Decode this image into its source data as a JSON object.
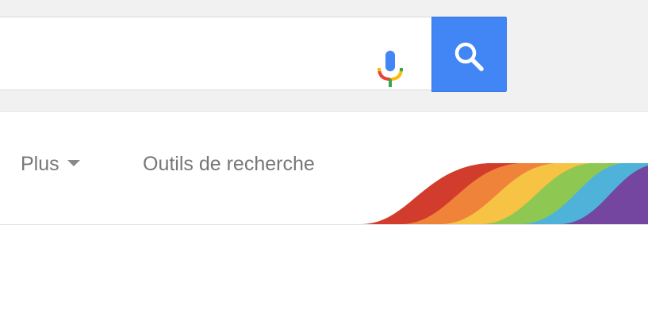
{
  "search": {
    "value": "",
    "placeholder": "",
    "button_label": "Rechercher"
  },
  "icons": {
    "mic": "microphone-icon",
    "search": "magnifier-icon",
    "dropdown": "caret-down-icon"
  },
  "nav": {
    "more_label": "Plus",
    "tools_label": "Outils de recherche"
  },
  "colors": {
    "header_bg": "#f1f1f1",
    "search_button": "#4285f4",
    "nav_text": "#777777",
    "rainbow": [
      "#d23c2c",
      "#f0833a",
      "#f6c344",
      "#8fc753",
      "#4fb3d9",
      "#7546a0"
    ]
  }
}
